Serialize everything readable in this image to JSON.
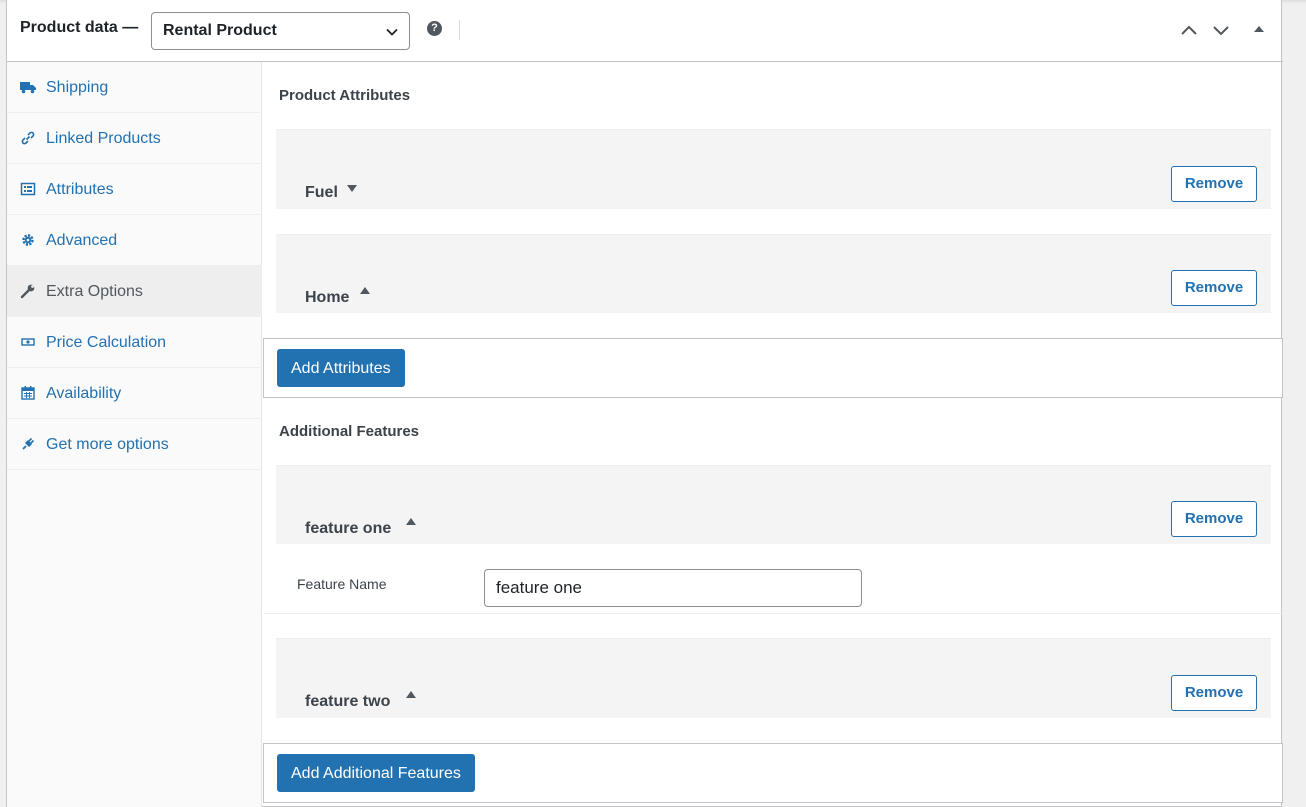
{
  "header": {
    "title": "Product data —",
    "product_type": "Rental Product",
    "help_glyph": "?"
  },
  "sidebar": {
    "items": [
      {
        "label": "Shipping",
        "icon": "truck-icon"
      },
      {
        "label": "Linked Products",
        "icon": "link-icon"
      },
      {
        "label": "Attributes",
        "icon": "list-view-icon"
      },
      {
        "label": "Advanced",
        "icon": "gear-icon"
      },
      {
        "label": "Extra Options",
        "icon": "wrench-icon",
        "active": true
      },
      {
        "label": "Price Calculation",
        "icon": "money-icon"
      },
      {
        "label": "Availability",
        "icon": "calendar-icon"
      },
      {
        "label": "Get more options",
        "icon": "plugin-icon"
      }
    ]
  },
  "attributes": {
    "title": "Product Attributes",
    "items": [
      {
        "name": "Fuel",
        "expanded": false
      },
      {
        "name": "Home",
        "expanded": true
      }
    ],
    "remove_label": "Remove",
    "add_label": "Add Attributes"
  },
  "features": {
    "title": "Additional Features",
    "items": [
      {
        "name": "feature one",
        "field_label": "Feature Name",
        "field_value": "feature one"
      },
      {
        "name": "feature two"
      }
    ],
    "remove_label": "Remove",
    "add_label": "Add Additional Features"
  },
  "colors": {
    "accent": "#2271b1",
    "text": "#1d2327",
    "border": "#c3c4c7"
  }
}
